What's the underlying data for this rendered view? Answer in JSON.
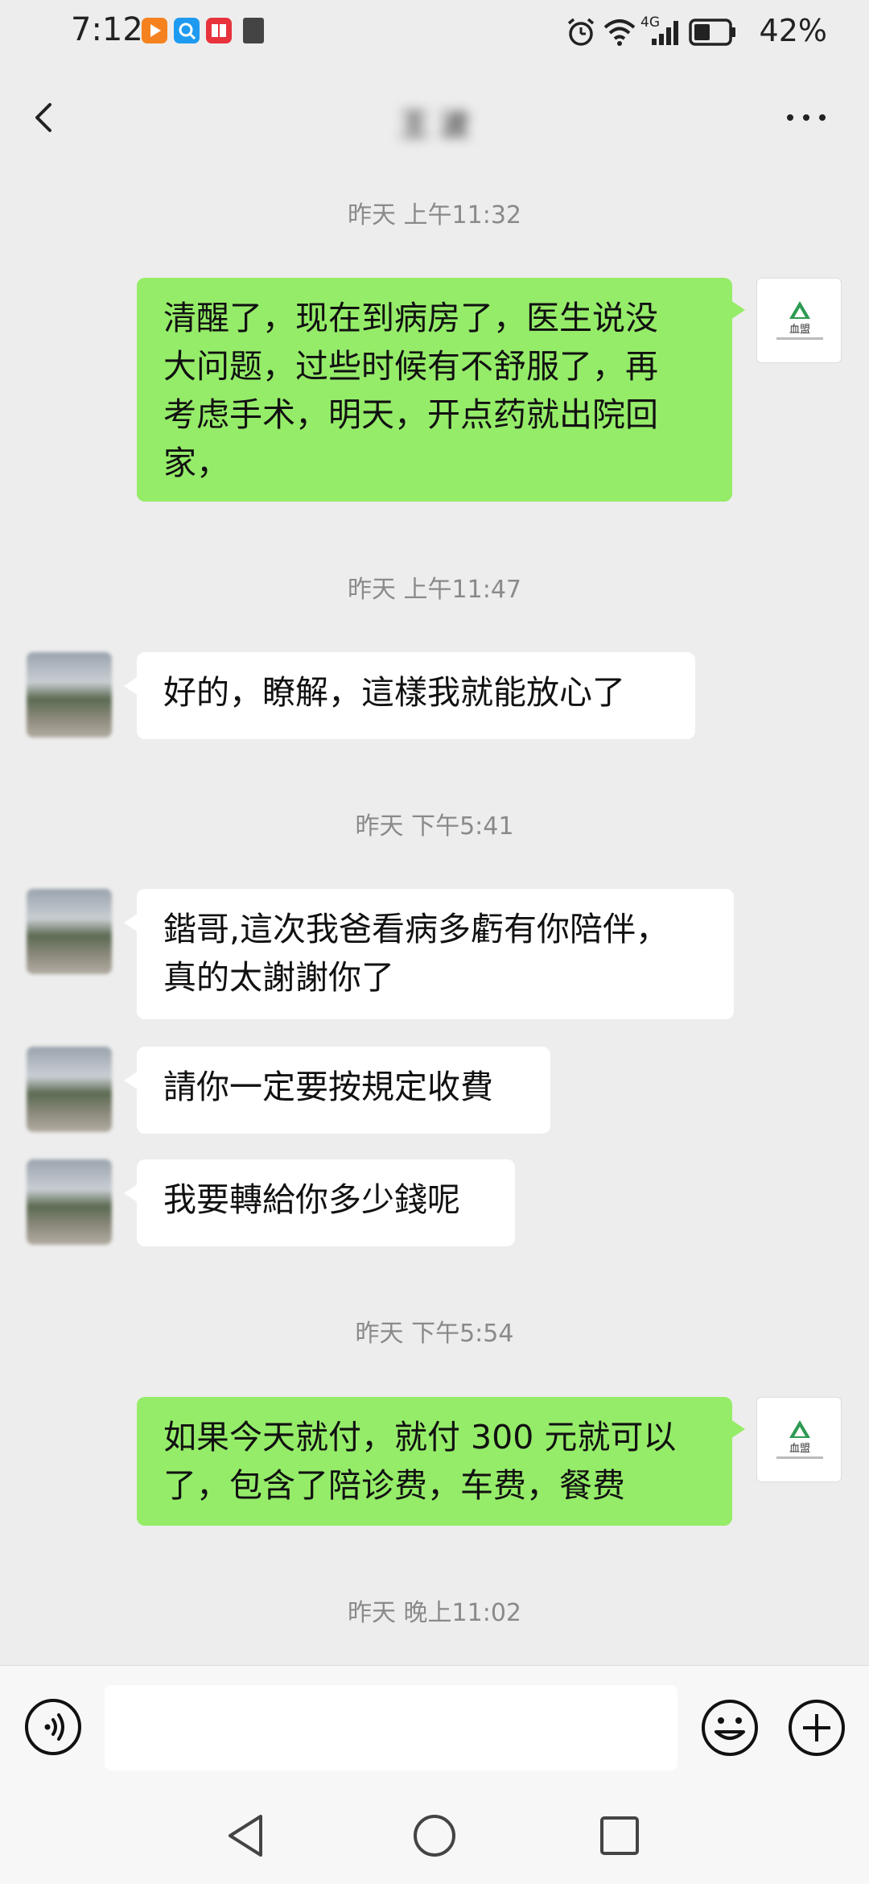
{
  "status_bar": {
    "time": "7:12",
    "icons_left": [
      "video-app-icon",
      "search-app-icon",
      "book-app-icon",
      "sd-card-icon"
    ],
    "icons_right": [
      "alarm-icon",
      "wifi-icon",
      "4g-signal-icon",
      "battery-icon"
    ],
    "network": "4G",
    "battery": "42%"
  },
  "header": {
    "title": "王 波"
  },
  "messages": [
    {
      "type": "timestamp",
      "text": "昨天 上午11:32"
    },
    {
      "type": "out",
      "lines": [
        "清醒了，现在到病房了，医生说没",
        "大问题，过些时候有不舒服了，再",
        "考虑手术，明天，开点药就出院回",
        "家，"
      ]
    },
    {
      "type": "timestamp",
      "text": "昨天 上午11:47"
    },
    {
      "type": "in",
      "text": "好的，瞭解，這樣我就能放心了"
    },
    {
      "type": "timestamp",
      "text": "昨天 下午5:41"
    },
    {
      "type": "in",
      "lines": [
        "鍇哥,這次我爸看病多虧有你陪伴，",
        "真的太謝謝你了"
      ]
    },
    {
      "type": "in",
      "text": "請你一定要按規定收費"
    },
    {
      "type": "in",
      "text": "我要轉給你多少錢呢"
    },
    {
      "type": "timestamp",
      "text": "昨天 下午5:54"
    },
    {
      "type": "out",
      "lines": [
        "如果今天就付，就付 300 元就可以",
        "了，包含了陪诊费，车费，餐费"
      ]
    },
    {
      "type": "timestamp",
      "text": "昨天 晚上11:02"
    }
  ],
  "my_avatar": {
    "label": "血盟",
    "brand_color": "#2e9a52"
  },
  "input_bar": {
    "value": "",
    "placeholder": ""
  },
  "colors": {
    "outgoing_bubble": "#95ec69",
    "incoming_bubble": "#ffffff",
    "chat_background": "#ededed"
  }
}
